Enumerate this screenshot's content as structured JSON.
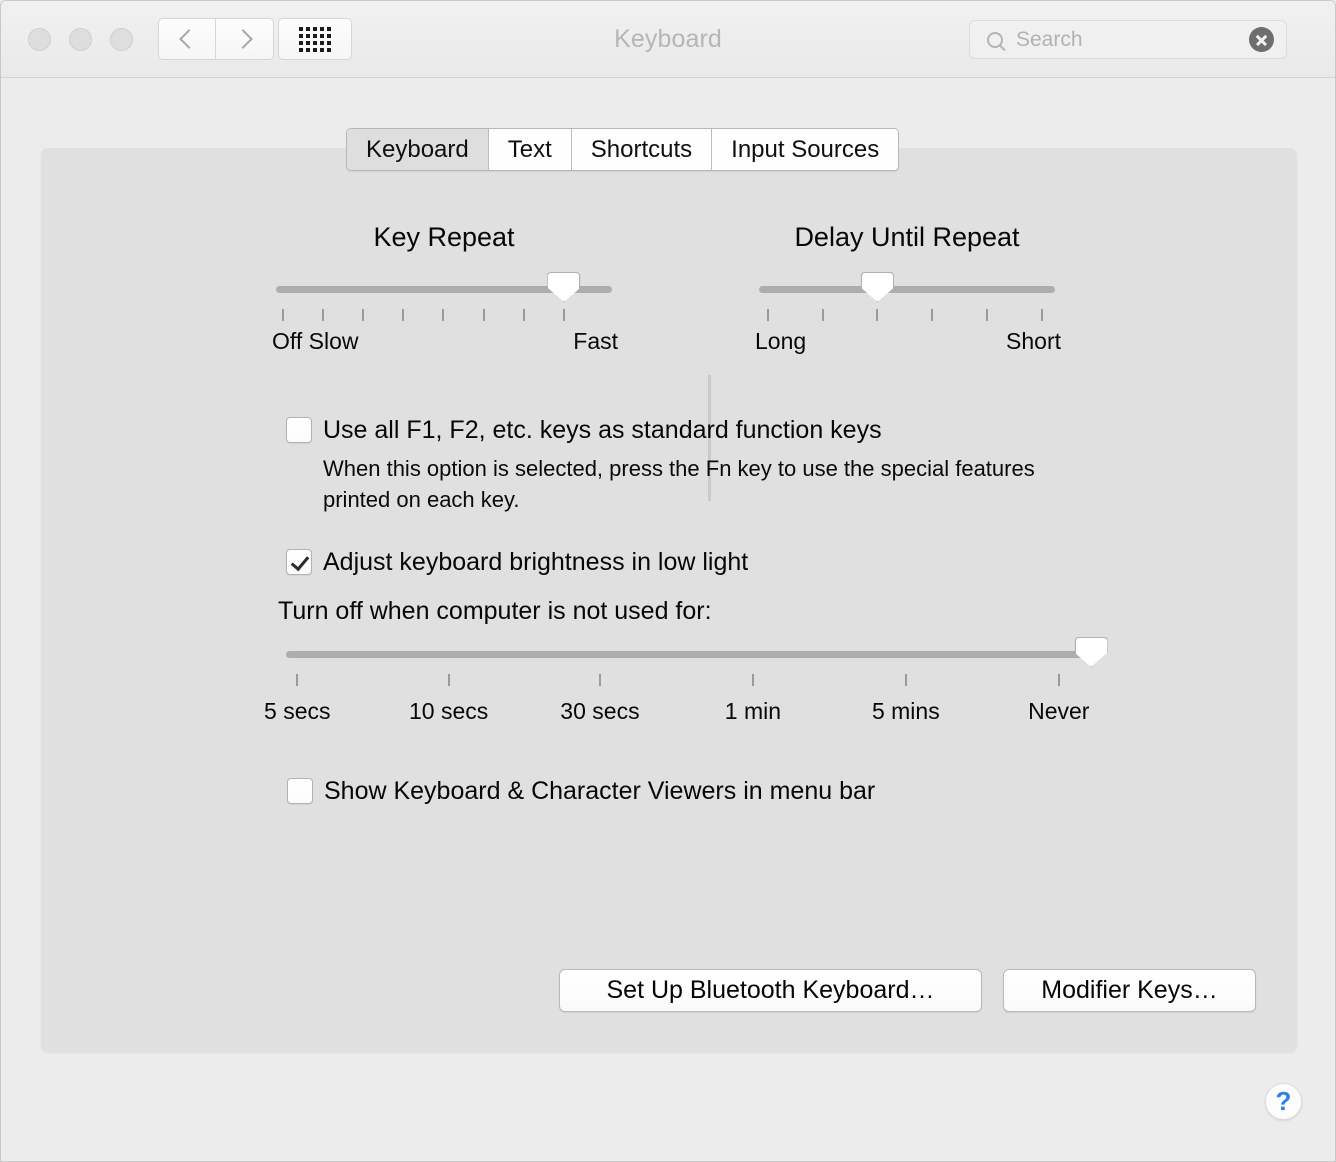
{
  "window": {
    "title": "Keyboard",
    "traffic_lights": [
      "close",
      "minimize",
      "zoom"
    ],
    "nav": {
      "back_icon": "chevron-left-icon",
      "forward_icon": "chevron-right-icon",
      "grid_icon": "grid-view-icon"
    }
  },
  "search": {
    "placeholder": "Search",
    "value": "",
    "icon": "search-icon",
    "clear_icon": "clear-circle-icon"
  },
  "tabs": [
    {
      "label": "Keyboard",
      "selected": true
    },
    {
      "label": "Text",
      "selected": false
    },
    {
      "label": "Shortcuts",
      "selected": false
    },
    {
      "label": "Input Sources",
      "selected": false
    }
  ],
  "sliders": {
    "key_repeat": {
      "title": "Key Repeat",
      "left_label": "Off Slow",
      "right_label": "Fast",
      "ticks": 8,
      "value_index": 6,
      "percent": 85.7
    },
    "delay_until_repeat": {
      "title": "Delay Until Repeat",
      "left_label": "Long",
      "right_label": "Short",
      "ticks": 6,
      "value_index": 2,
      "percent": 40.0
    },
    "keyboard_timeout": {
      "labels": [
        "5 secs",
        "10 secs",
        "30 secs",
        "1 min",
        "5 mins",
        "Never"
      ],
      "ticks": 6,
      "value_index": 5,
      "value": "Never",
      "percent": 100
    }
  },
  "checkboxes": {
    "function_keys": {
      "label": "Use all F1, F2, etc. keys as standard function keys",
      "checked": false,
      "help": "When this option is selected, press the Fn key to use the special features printed on each key."
    },
    "brightness": {
      "label": "Adjust keyboard brightness in low light",
      "checked": true
    },
    "viewers": {
      "label": "Show Keyboard & Character Viewers in menu bar",
      "checked": false
    }
  },
  "timeout_section_label": "Turn off when computer is not used for:",
  "buttons": {
    "bluetooth": "Set Up Bluetooth Keyboard…",
    "modifier": "Modifier Keys…",
    "help": "?"
  },
  "colors": {
    "window_bg": "#ececec",
    "panel_bg": "#e0e0e0",
    "titlebar_bg": "#f1f1f1",
    "track": "#adadad",
    "help_blue": "#2d7ff0",
    "title_text": "#b6b6b6"
  }
}
